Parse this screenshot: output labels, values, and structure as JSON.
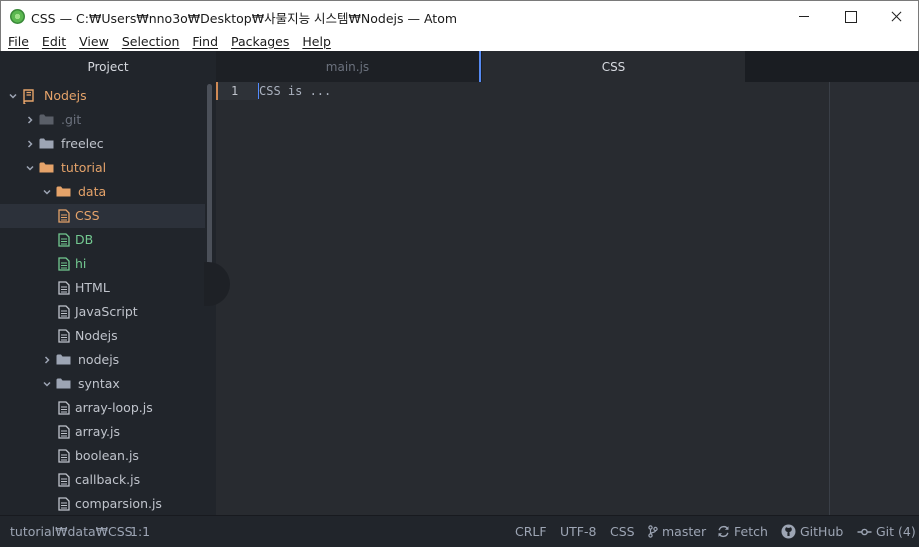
{
  "window": {
    "title": "CSS — C:₩Users₩nno3o₩Desktop₩사물지능 시스템₩Nodejs — Atom"
  },
  "menu": [
    "File",
    "Edit",
    "View",
    "Selection",
    "Find",
    "Packages",
    "Help"
  ],
  "tabs": {
    "project": "Project",
    "file1": "main.js",
    "file2": "CSS"
  },
  "tree": [
    {
      "label": "Nodejs",
      "kind": "root",
      "expanded": true,
      "color": "#e5a36a"
    },
    {
      "label": ".git",
      "kind": "folder",
      "expanded": false,
      "color": "#6b717d"
    },
    {
      "label": "freelec",
      "kind": "folder",
      "expanded": false,
      "color": "#c0c4cc"
    },
    {
      "label": "tutorial",
      "kind": "folder",
      "expanded": true,
      "color": "#e5a36a"
    },
    {
      "label": "data",
      "kind": "folder",
      "expanded": true,
      "color": "#e5a36a"
    },
    {
      "label": "CSS",
      "kind": "file",
      "color": "#e5a36a",
      "selected": true
    },
    {
      "label": "DB",
      "kind": "file",
      "color": "#73c991"
    },
    {
      "label": "hi",
      "kind": "file",
      "color": "#73c991"
    },
    {
      "label": "HTML",
      "kind": "file",
      "color": "#c0c4cc"
    },
    {
      "label": "JavaScript",
      "kind": "file",
      "color": "#c0c4cc"
    },
    {
      "label": "Nodejs",
      "kind": "file",
      "color": "#c0c4cc"
    },
    {
      "label": "nodejs",
      "kind": "folder",
      "expanded": false,
      "color": "#c0c4cc"
    },
    {
      "label": "syntax",
      "kind": "folder",
      "expanded": true,
      "color": "#c0c4cc"
    },
    {
      "label": "array-loop.js",
      "kind": "file",
      "color": "#c0c4cc"
    },
    {
      "label": "array.js",
      "kind": "file",
      "color": "#c0c4cc"
    },
    {
      "label": "boolean.js",
      "kind": "file",
      "color": "#c0c4cc"
    },
    {
      "label": "callback.js",
      "kind": "file",
      "color": "#c0c4cc"
    },
    {
      "label": "comparsion.js",
      "kind": "file",
      "color": "#c0c4cc"
    }
  ],
  "editor": {
    "line_number": "1",
    "line_text": "CSS is ..."
  },
  "status": {
    "path": "tutorial₩data₩CSS",
    "cursor": "1:1",
    "line_ending": "CRLF",
    "encoding": "UTF-8",
    "grammar": "CSS",
    "branch": "master",
    "fetch": "Fetch",
    "github": "GitHub",
    "git": "Git (4)"
  },
  "colors": {
    "accent": "#568af2",
    "modified": "#e5a36a",
    "added": "#73c991"
  }
}
